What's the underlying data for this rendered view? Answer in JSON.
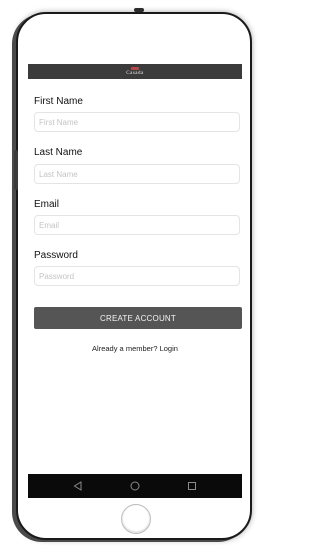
{
  "brand": {
    "name": "Casada"
  },
  "form": {
    "first_name": {
      "label": "First Name",
      "placeholder": "First Name",
      "value": ""
    },
    "last_name": {
      "label": "Last Name",
      "placeholder": "Last Name",
      "value": ""
    },
    "email": {
      "label": "Email",
      "placeholder": "Email",
      "value": ""
    },
    "password": {
      "label": "Password",
      "placeholder": "Password",
      "value": ""
    }
  },
  "actions": {
    "create_account_label": "CREATE ACCOUNT",
    "login_link_text": "Already a member? Login"
  },
  "nav": {
    "back_icon": "back-triangle-icon",
    "home_icon": "home-circle-icon",
    "recents_icon": "recents-square-icon"
  },
  "colors": {
    "header_bar": "#3b3b3b",
    "logo_accent": "#b5474a",
    "button_bg": "#555555",
    "nav_bar": "#0a0a0a"
  }
}
